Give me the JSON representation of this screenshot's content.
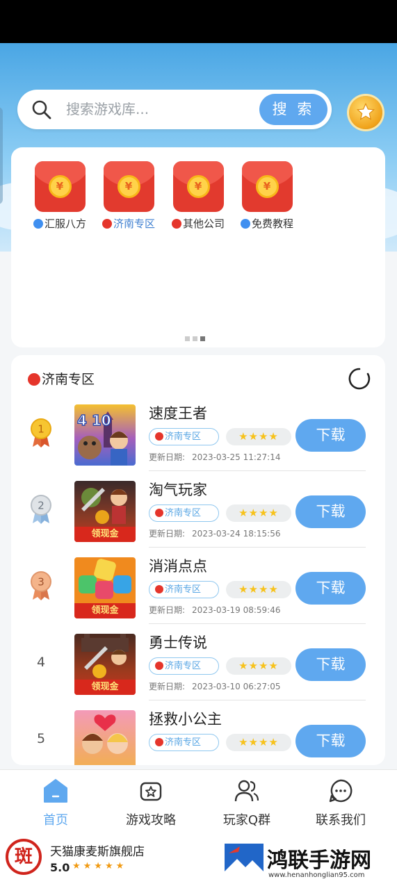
{
  "search": {
    "placeholder": "搜索游戏库...",
    "button_label": "搜 索"
  },
  "categories": [
    {
      "label": "汇服八方",
      "dot": "blue"
    },
    {
      "label": "济南专区",
      "dot": "red"
    },
    {
      "label": "其他公司",
      "dot": "red"
    },
    {
      "label": "免费教程",
      "dot": "blue"
    }
  ],
  "category_coin_symbol": "¥",
  "carousel": {
    "pages": 3,
    "active_page": 3
  },
  "list": {
    "title": "济南专区",
    "date_label": "更新日期:",
    "download_label": "下载",
    "games": [
      {
        "rank": "1",
        "name": "速度王者",
        "zone": "济南专区",
        "stars": "★★★★",
        "date": "2023-03-25 11:27:14",
        "thumb_label": "",
        "thumb_text": "4 10"
      },
      {
        "rank": "2",
        "name": "淘气玩家",
        "zone": "济南专区",
        "stars": "★★★★",
        "date": "2023-03-24 18:15:56",
        "thumb_label": "领现金",
        "thumb_text": ""
      },
      {
        "rank": "3",
        "name": "消消点点",
        "zone": "济南专区",
        "stars": "★★★★",
        "date": "2023-03-19 08:59:46",
        "thumb_label": "领现金",
        "thumb_text": ""
      },
      {
        "rank": "4",
        "name": "勇士传说",
        "zone": "济南专区",
        "stars": "★★★★",
        "date": "2023-03-10 06:27:05",
        "thumb_label": "领现金",
        "thumb_text": ""
      },
      {
        "rank": "5",
        "name": "拯救小公主",
        "zone": "济南专区",
        "stars": "★★★★",
        "date": "",
        "thumb_label": "",
        "thumb_text": ""
      }
    ]
  },
  "tabbar": [
    {
      "label": "首页",
      "icon": "home-icon",
      "active": true
    },
    {
      "label": "游戏攻略",
      "icon": "guide-icon",
      "active": false
    },
    {
      "label": "玩家Q群",
      "icon": "group-icon",
      "active": false
    },
    {
      "label": "联系我们",
      "icon": "chat-icon",
      "active": false
    }
  ],
  "ad": {
    "logo_text": "斑",
    "name": "天猫康麦斯旗舰店",
    "score": "5.0",
    "stars": "★★★★★"
  },
  "watermark": {
    "title": "鸿联手游网",
    "url": "www.henanhonglian95.com"
  },
  "colors": {
    "accent": "#5fa8ef",
    "red_envelope": "#e23a2e",
    "gold": "#f7c21b"
  }
}
